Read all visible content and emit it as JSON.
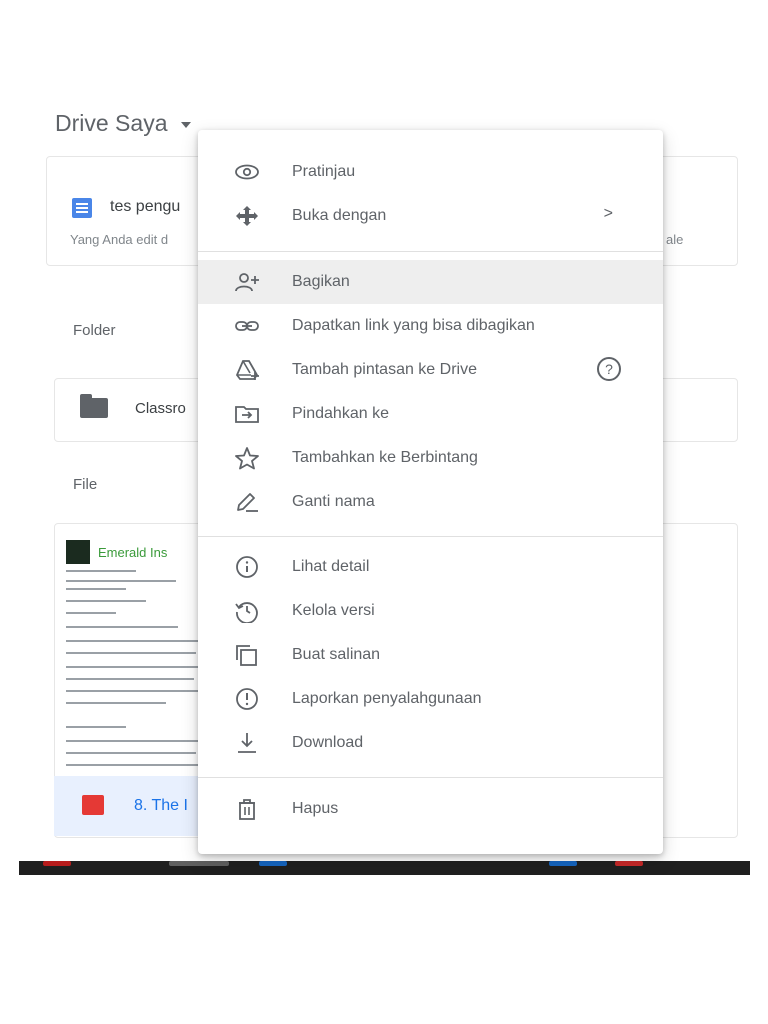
{
  "header": {
    "title": "Drive Saya"
  },
  "quick_access": {
    "item_name": "tes pengu",
    "item_sub": "Yang Anda edit d",
    "item_sub_right": "ale"
  },
  "sections": {
    "folders": "Folder",
    "files": "File"
  },
  "folder": {
    "name": "Classro"
  },
  "file": {
    "brand": "Emerald Ins",
    "name": "8. The I"
  },
  "context_menu": {
    "items": [
      {
        "label": "Pratinjau",
        "icon": "eye-icon"
      },
      {
        "label": "Buka dengan",
        "icon": "open-with-icon",
        "right": ">"
      },
      {
        "label": "Bagikan",
        "icon": "share-person-add-icon"
      },
      {
        "label": "Dapatkan link yang bisa dibagikan",
        "icon": "link-icon"
      },
      {
        "label": "Tambah pintasan ke Drive",
        "icon": "drive-shortcut-icon",
        "help": "?"
      },
      {
        "label": "Pindahkan ke",
        "icon": "move-to-folder-icon"
      },
      {
        "label": "Tambahkan ke Berbintang",
        "icon": "star-icon"
      },
      {
        "label": "Ganti nama",
        "icon": "rename-pencil-icon"
      },
      {
        "label": "Lihat detail",
        "icon": "info-icon"
      },
      {
        "label": "Kelola versi",
        "icon": "history-icon"
      },
      {
        "label": "Buat salinan",
        "icon": "copy-icon"
      },
      {
        "label": "Laporkan penyalahgunaan",
        "icon": "report-icon"
      },
      {
        "label": "Download",
        "icon": "download-icon"
      },
      {
        "label": "Hapus",
        "icon": "trash-icon"
      }
    ]
  },
  "colors": {
    "accent": "#1a73e8",
    "highlight": "#eeeeee",
    "text": "#5f6368"
  }
}
